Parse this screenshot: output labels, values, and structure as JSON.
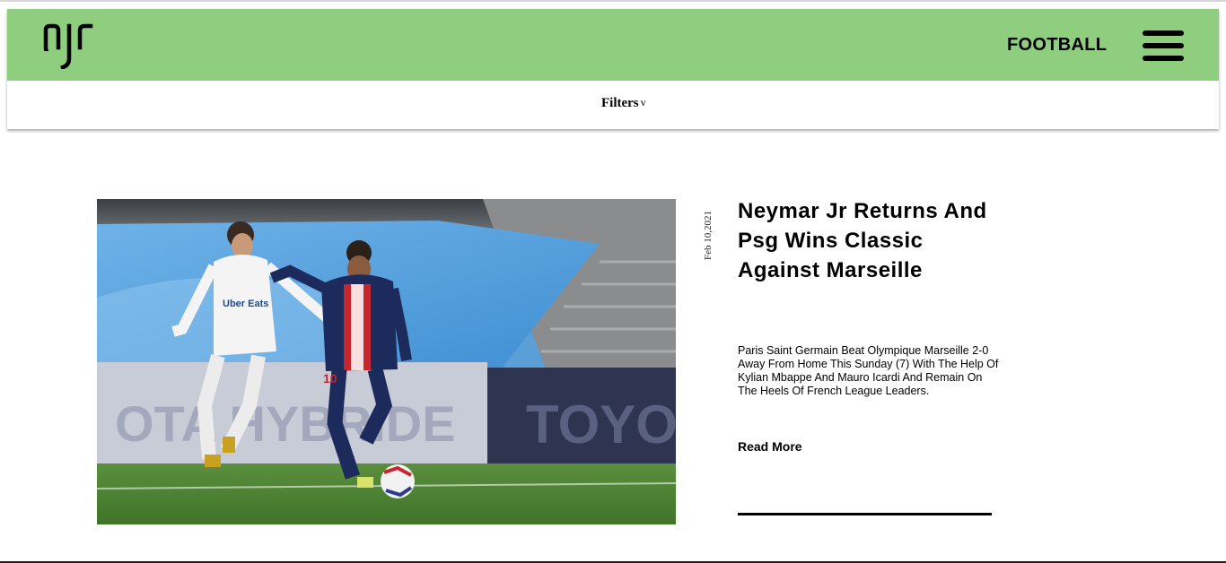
{
  "header": {
    "logo_text": "njr",
    "nav_label": "FOOTBALL",
    "bg_color": "#8fce7f"
  },
  "filters": {
    "label": "Filters",
    "chevron": "v"
  },
  "article": {
    "date": "Feb 10,2021",
    "title": "Neymar Jr Returns And Psg Wins Classic Against Marseille",
    "excerpt": "Paris Saint Germain Beat Olympique Marseille 2-0 Away From Home This Sunday (7) With The Help Of Kylian Mbappe And Mauro Icardi And Remain On The Heels Of French League Leaders.",
    "read_more": "Read More",
    "image_text": {
      "sponsor": "Uber\nEats",
      "ad_left": "OTA HYBRIDE",
      "ad_right": "TOYO",
      "jersey_number": "10"
    }
  },
  "icons": {
    "logo": "njr-logo-icon",
    "menu": "hamburger-menu-icon",
    "chevron": "chevron-down-icon"
  }
}
